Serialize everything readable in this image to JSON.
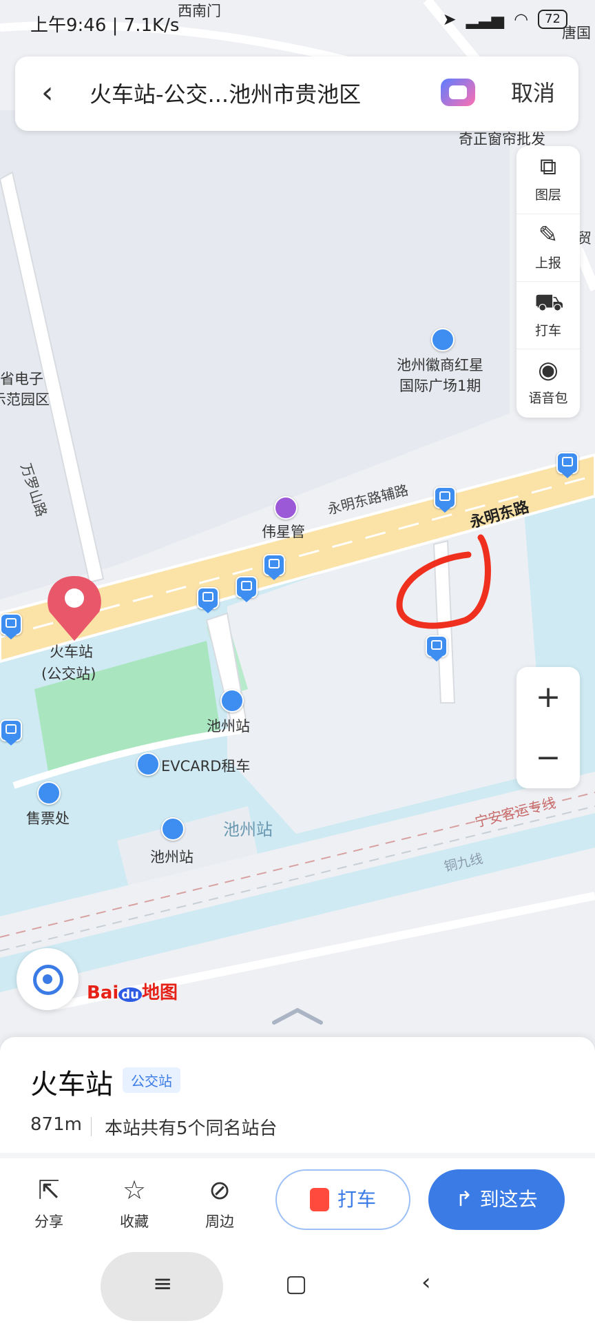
{
  "status_bar": {
    "time": "上午9:46 | 7.1K/s",
    "battery": "72"
  },
  "header": {
    "query": "火车站-公交...池州市贵池区",
    "cancel_label": "取消"
  },
  "toolbar": {
    "items": [
      {
        "label": "图层",
        "icon": "layers-icon"
      },
      {
        "label": "上报",
        "icon": "report-icon"
      },
      {
        "label": "打车",
        "icon": "taxi-icon"
      },
      {
        "label": "语音包",
        "icon": "voice-pack-icon"
      }
    ]
  },
  "zoom": {
    "plus": "+",
    "minus": "−"
  },
  "map": {
    "labels": {
      "west_gate": "西南门",
      "tangguo": "唐国",
      "qizheng": "奇正窗帘批发",
      "mao": "贸",
      "shengdianzi": "省电子",
      "fanyuanqu": "示范园区",
      "wanluoshan": "万罗山路",
      "huishang": "池州徽商红星",
      "guoji": "国际广场1期",
      "yongming_aux": "永明东路辅路",
      "yongming": "永明东路",
      "weixingguan": "伟星管",
      "station_name": "火车站",
      "station_sub": "(公交站)",
      "chizhou_stop": "池州站",
      "evcard": "EVCARD租车",
      "ticket": "售票处",
      "chizhou_area": "池州站",
      "chizhou_rail": "池州站",
      "ningan": "宁安客运专线",
      "tongjiu": "铜九线"
    },
    "logo": {
      "bai": "Bai",
      "du": "du",
      "map": "地图"
    }
  },
  "sheet": {
    "title": "火车站",
    "badge": "公交站",
    "distance": "871m",
    "description": "本站共有5个同名站台",
    "actions": [
      {
        "label": "分享",
        "icon": "share-icon"
      },
      {
        "label": "收藏",
        "icon": "star-icon"
      },
      {
        "label": "周边",
        "icon": "compass-icon"
      }
    ],
    "taxi_label": "打车",
    "go_label": "到这去"
  },
  "colors": {
    "accent": "#3a7be6",
    "road": "#fbe3a8",
    "water": "#cfeaf3",
    "green": "#a9e6c0",
    "annotation": "#f0301e",
    "pin": "#e8576a"
  }
}
